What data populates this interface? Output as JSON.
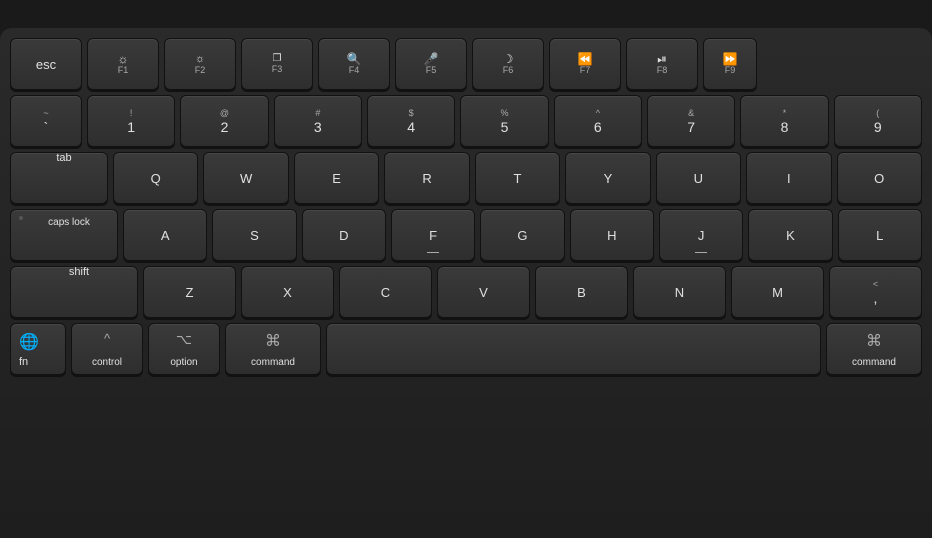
{
  "keyboard": {
    "bg_color": "#1e1e1e",
    "rows": {
      "fn_row": {
        "keys": [
          {
            "id": "esc",
            "label": "esc",
            "size": "esc"
          },
          {
            "id": "f1",
            "icon": "☀",
            "sub": "F1",
            "size": "f1"
          },
          {
            "id": "f2",
            "icon": "☀",
            "sub": "F2",
            "size": "f1"
          },
          {
            "id": "f3",
            "icon": "⊞",
            "sub": "F3",
            "size": "f1"
          },
          {
            "id": "f4",
            "icon": "🔍",
            "sub": "F4",
            "size": "f1"
          },
          {
            "id": "f5",
            "icon": "🎤",
            "sub": "F5",
            "size": "f1"
          },
          {
            "id": "f6",
            "icon": "☾",
            "sub": "F6",
            "size": "f1"
          },
          {
            "id": "f7",
            "icon": "⏮",
            "sub": "F7",
            "size": "f1"
          },
          {
            "id": "f8",
            "icon": "⏯",
            "sub": "F8",
            "size": "f1"
          },
          {
            "id": "f9",
            "icon": "⏭",
            "sub": "F9",
            "size": "f9"
          }
        ]
      },
      "number_row": {
        "keys": [
          {
            "id": "tilde",
            "top": "~",
            "bot": "`",
            "size": "tilde"
          },
          {
            "id": "1",
            "top": "!",
            "bot": "1"
          },
          {
            "id": "2",
            "top": "@",
            "bot": "2"
          },
          {
            "id": "3",
            "top": "#",
            "bot": "3"
          },
          {
            "id": "4",
            "top": "$",
            "bot": "4"
          },
          {
            "id": "5",
            "top": "%",
            "bot": "5"
          },
          {
            "id": "6",
            "top": "^",
            "bot": "6"
          },
          {
            "id": "7",
            "top": "&",
            "bot": "7"
          },
          {
            "id": "8",
            "top": "*",
            "bot": "8"
          },
          {
            "id": "9",
            "top": "(",
            "bot": "9"
          }
        ]
      },
      "qwerty_row": {
        "label": "tab",
        "keys": [
          "Q",
          "W",
          "E",
          "R",
          "T",
          "Y",
          "U",
          "I",
          "O"
        ]
      },
      "asdf_row": {
        "label": "caps lock",
        "keys": [
          "A",
          "S",
          "D",
          "F",
          "G",
          "H",
          "J",
          "K",
          "L"
        ]
      },
      "zxcv_row": {
        "label": "shift",
        "keys": [
          "Z",
          "X",
          "C",
          "V",
          "B",
          "N",
          "M"
        ]
      },
      "bottom_row": {
        "fn_label": "fn",
        "globe_icon": "🌐",
        "ctrl_label": "control",
        "ctrl_icon": "^",
        "opt_label": "option",
        "opt_icon": "⌥",
        "cmd_label": "command",
        "cmd_icon": "⌘",
        "cmd_right_label": "command",
        "cmd_right_icon": "⌘"
      }
    }
  }
}
